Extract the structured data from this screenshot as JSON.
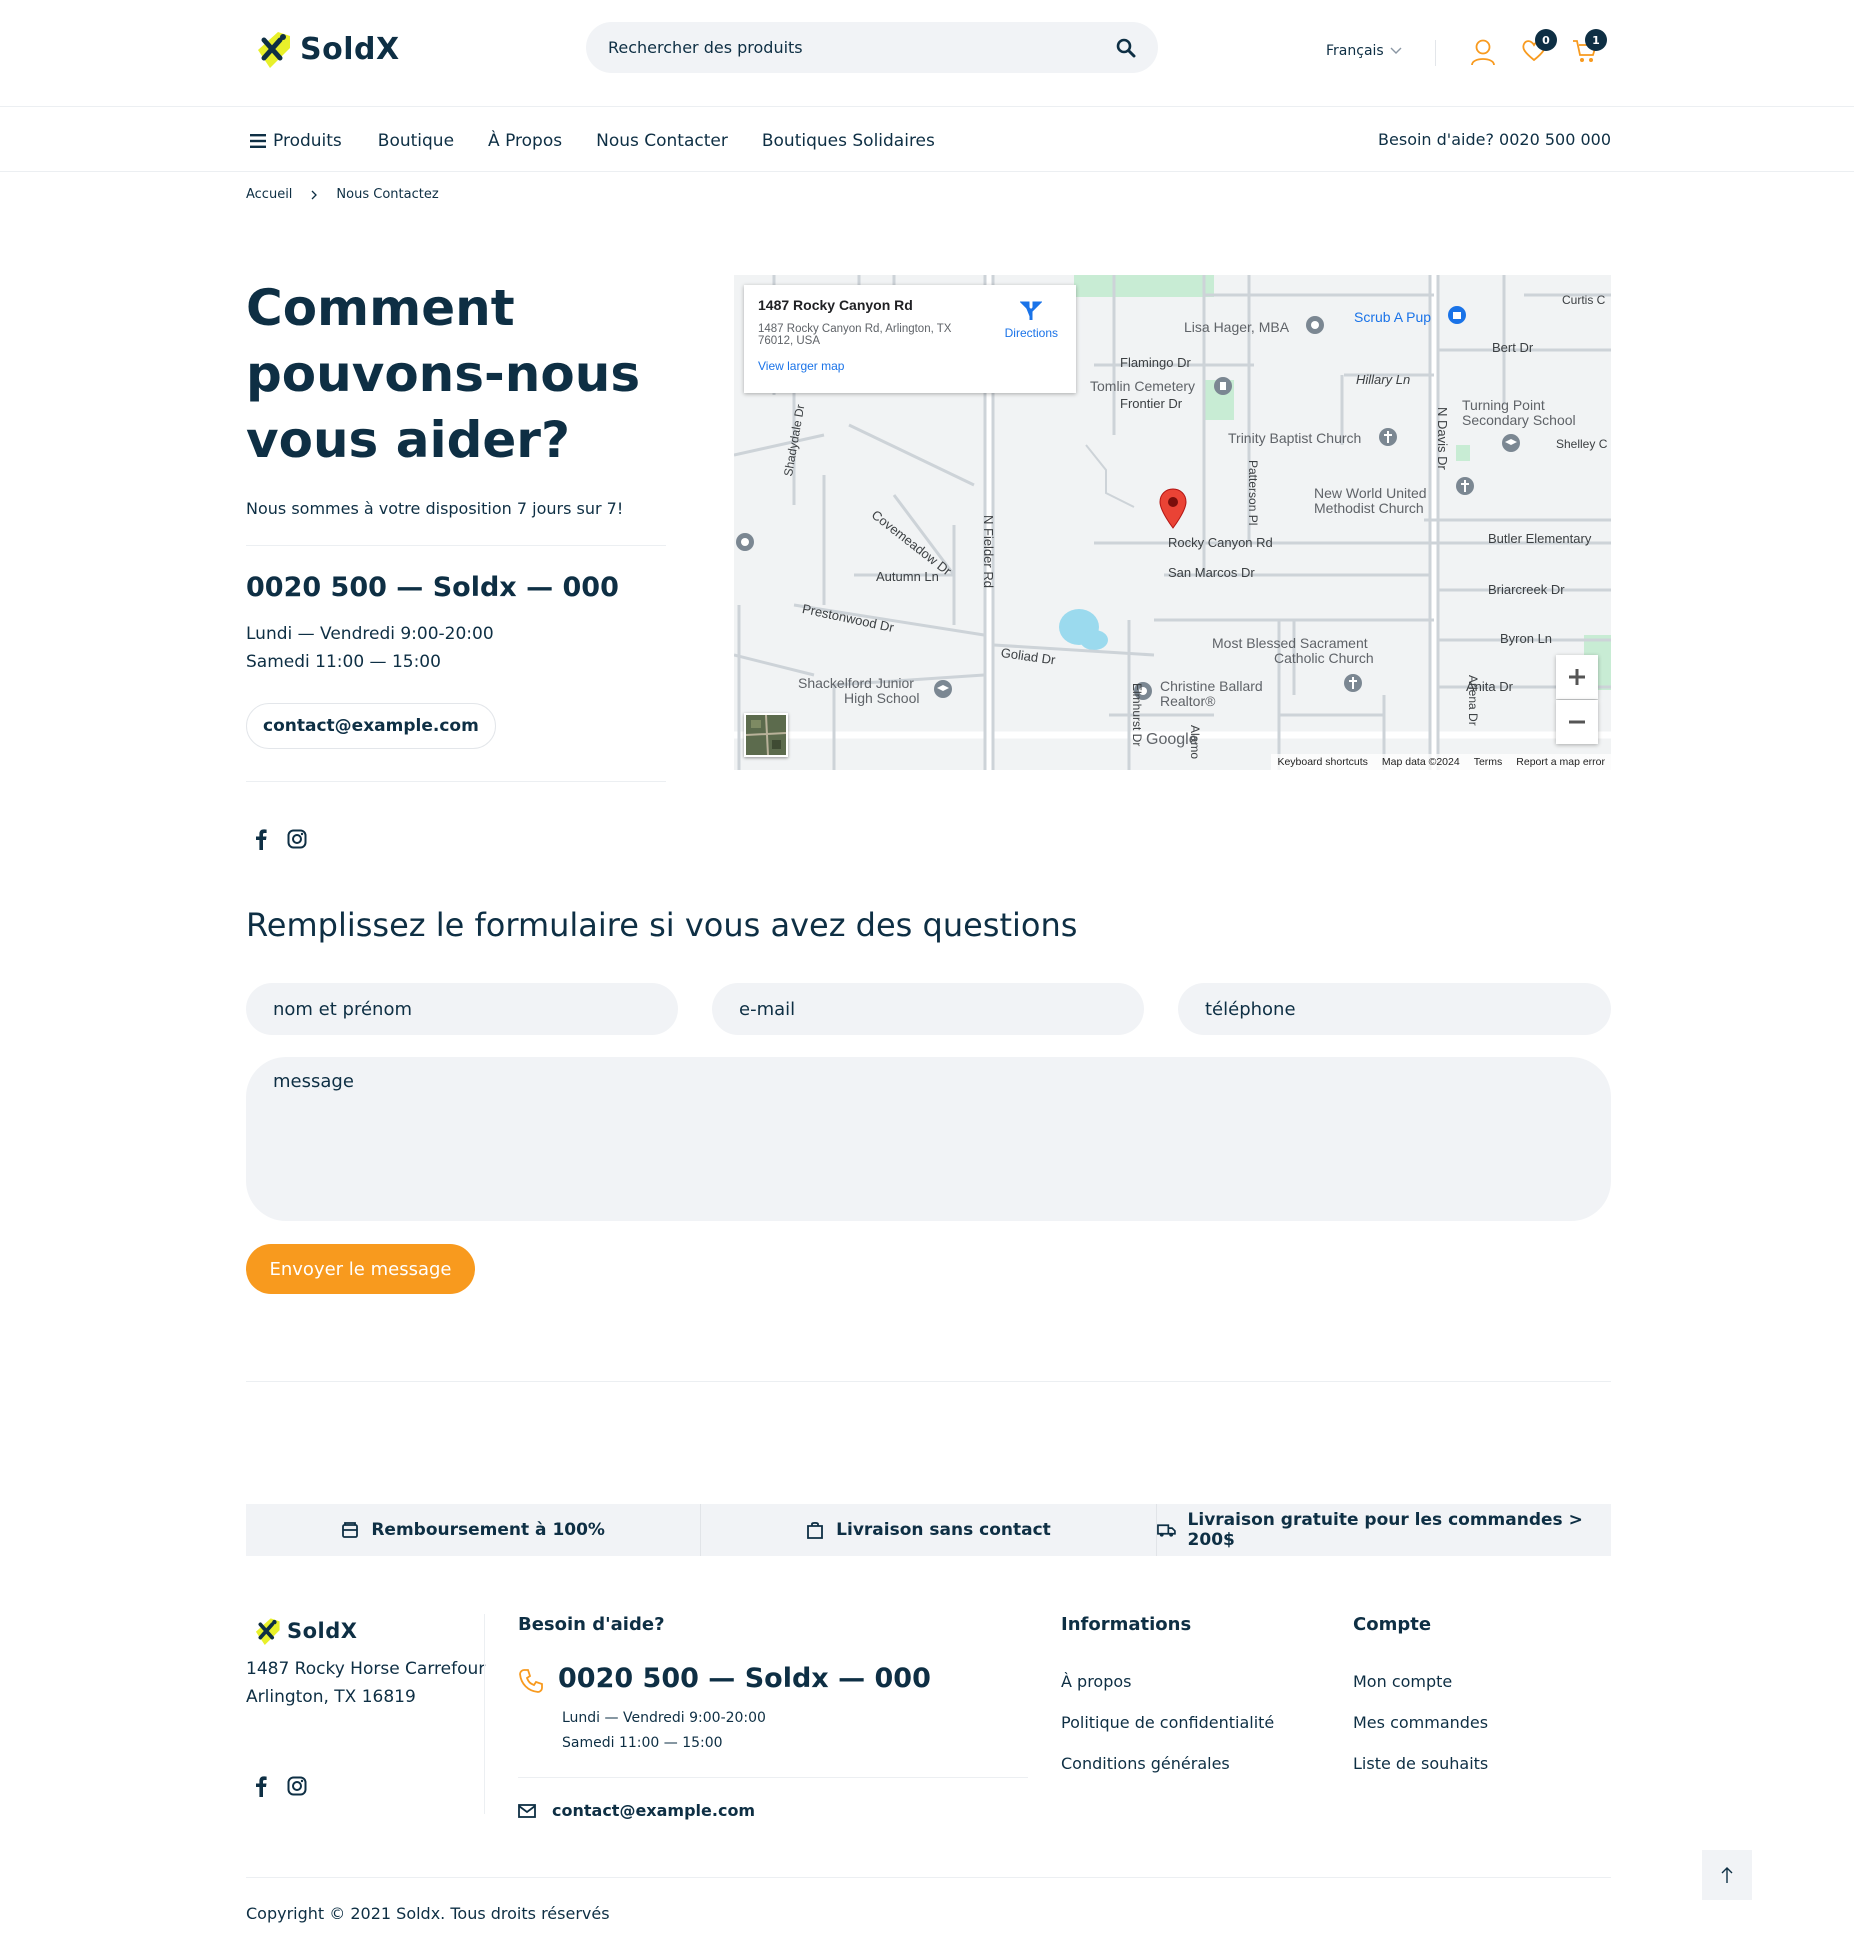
{
  "header": {
    "logo": "SoldX",
    "search_placeholder": "Rechercher des produits",
    "language": "Français",
    "wishlist_count": "0",
    "cart_count": "1"
  },
  "nav": {
    "items": [
      "Produits",
      "Boutique",
      "À Propos",
      "Nous Contacter",
      "Boutiques Solidaires"
    ],
    "help": "Besoin d'aide? 0020 500 000"
  },
  "breadcrumb": {
    "home": "Accueil",
    "current": "Nous Contactez"
  },
  "contact": {
    "title_1": "Comment",
    "title_2": "pouvons-nous",
    "title_3": "vous aider?",
    "availability": "Nous sommes à votre disposition 7 jours sur 7!",
    "phone": "0020 500 — Soldx — 000",
    "hours_week": "Lundi — Vendredi 9:00-20:00",
    "hours_sat": "Samedi 11:00 — 15:00",
    "email": "contact@example.com"
  },
  "map": {
    "place_title": "1487 Rocky Canyon Rd",
    "place_address_1": "1487 Rocky Canyon Rd, Arlington, TX",
    "place_address_2": "76012, USA",
    "directions": "Directions",
    "larger_map": "View larger map",
    "labels": {
      "lisa": "Lisa Hager, MBA",
      "scrub": "Scrub A Pup",
      "curtis": "Curtis C",
      "bert": "Bert Dr",
      "flamingo": "Flamingo Dr",
      "hillary": "Hillary Ln",
      "tomlin": "Tomlin Cemetery",
      "frontier": "Frontier Dr",
      "turning_1": "Turning Point",
      "turning_2": "Secondary School",
      "shelley": "Shelley C",
      "trinity": "Trinity Baptist Church",
      "nw_1": "New World United",
      "nw_2": "Methodist Church",
      "butler": "Butler Elementary",
      "rocky": "Rocky Canyon Rd",
      "sanmarcos": "San Marcos Dr",
      "briarcreek": "Briarcreek Dr",
      "covemeadow": "Covemeadow Dr",
      "autumn": "Autumn Ln",
      "prestonwood": "Prestonwood Dr",
      "fielder": "N Fielder Rd",
      "goliad": "Goliad Dr",
      "mostblessed_1": "Most Blessed Sacrament",
      "mostblessed_2": "Catholic Church",
      "byron": "Byron Ln",
      "shackelford_1": "Shackelford Junior",
      "shackelford_2": "High School",
      "christine_1": "Christine Ballard",
      "christine_2": "Realtor®",
      "anita": "Anita Dr",
      "ndavis": "N Davis Dr",
      "patterson": "Patterson Pl",
      "shadydale": "Shadydale Dr",
      "elmhurst": "Elmhurst Dr",
      "arlena": "Arlena Dr",
      "alamo": "Alamo",
      "google": "Google"
    },
    "footer_links": [
      "Keyboard shortcuts",
      "Map data ©2024",
      "Terms",
      "Report a map error"
    ]
  },
  "social": {
    "facebook": "f",
    "instagram": "ig"
  },
  "form": {
    "title": "Remplissez le formulaire si vous avez des questions",
    "name_placeholder": "nom et prénom",
    "email_placeholder": "e-mail",
    "phone_placeholder": "téléphone",
    "message_placeholder": "message",
    "submit": "Envoyer le message"
  },
  "features": [
    "Remboursement à 100%",
    "Livraison sans contact",
    "Livraison gratuite pour les commandes > 200$"
  ],
  "footer": {
    "logo": "SoldX",
    "address_1": "1487 Rocky Horse Carrefour",
    "address_2": "Arlington, TX 16819",
    "help_title": "Besoin d'aide?",
    "phone": "0020 500 — Soldx — 000",
    "hours_week": "Lundi — Vendredi 9:00-20:00",
    "hours_sat": "Samedi 11:00 — 15:00",
    "email": "contact@example.com",
    "info_title": "Informations",
    "info_links": [
      "À propos",
      "Politique de confidentialité",
      "Conditions générales"
    ],
    "account_title": "Compte",
    "account_links": [
      "Mon compte",
      "Mes commandes",
      "Liste de souhaits"
    ],
    "copyright": "Copyright © 2021 Soldx. Tous droits réservés"
  },
  "colors": {
    "primary": "#0e2f44",
    "accent": "#f89a1e",
    "logo_yellow": "#e8f02a",
    "field_bg": "#f1f3f6"
  }
}
